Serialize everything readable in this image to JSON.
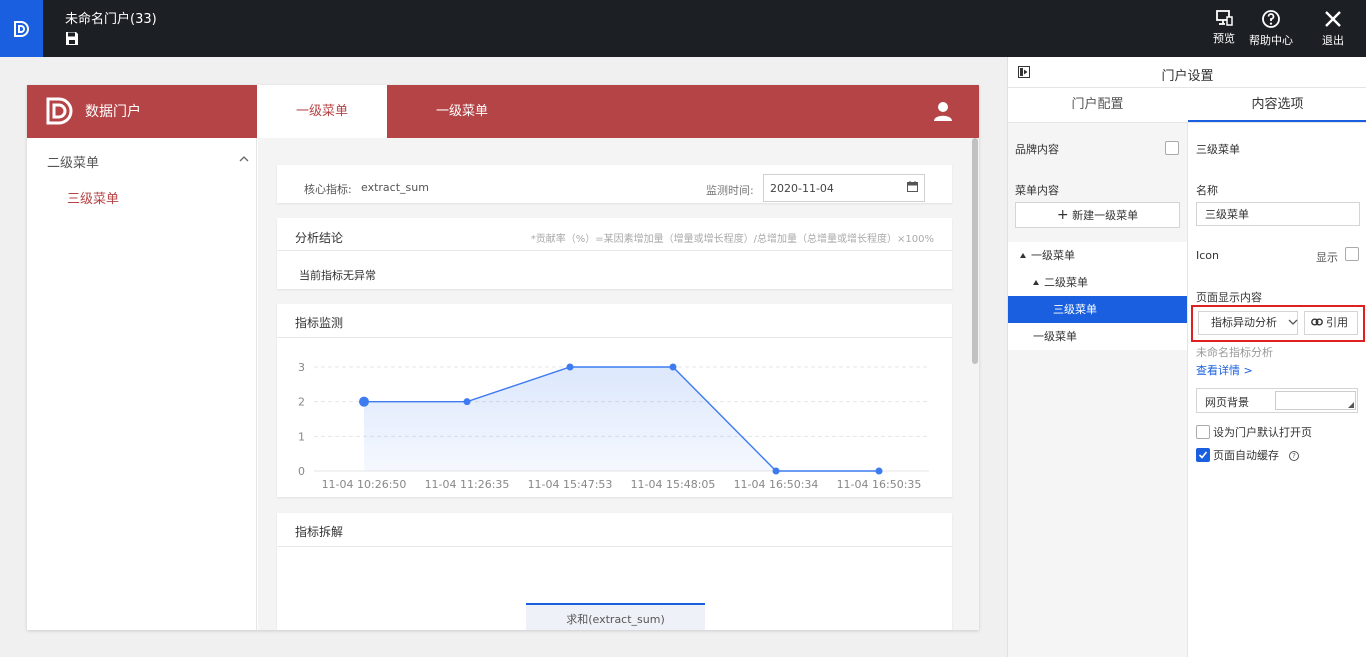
{
  "topbar": {
    "title": "未命名门户(33)",
    "actions": [
      {
        "label": "预览",
        "icon": "preview-icon"
      },
      {
        "label": "帮助中心",
        "icon": "help-icon"
      },
      {
        "label": "退出",
        "icon": "close-icon"
      }
    ]
  },
  "preview": {
    "brand": "数据门户",
    "tabs": [
      "一级菜单",
      "一级菜单"
    ],
    "sidebar": {
      "level2": "二级菜单",
      "level3": "三级菜单"
    },
    "filter": {
      "core_label": "核心指标:",
      "core_value": "extract_sum",
      "monitor_label": "监测时间:",
      "monitor_date": "2020-11-04"
    },
    "analysis": {
      "title": "分析结论",
      "formula": "*贡献率（%）=某因素增加量（增量或增长程度）/总增加量（总增量或增长程度）×100%",
      "result": "当前指标无异常"
    },
    "monitor": {
      "title": "指标监测"
    },
    "decompose": {
      "title": "指标拆解",
      "table_header": "求和(extract_sum)"
    }
  },
  "chart_data": {
    "type": "area",
    "categories": [
      "11-04 10:26:50",
      "11-04 11:26:35",
      "11-04 15:47:53",
      "11-04 15:48:05",
      "11-04 16:50:34",
      "11-04 16:50:35"
    ],
    "values": [
      2,
      2,
      3,
      3,
      0,
      0
    ],
    "ylim": [
      0,
      3
    ],
    "yticks": [
      0,
      1,
      2,
      3
    ],
    "grid": true,
    "color": "#3d7bf0"
  },
  "right_panel": {
    "title": "门户设置",
    "tabs": [
      "门户配置",
      "内容选项"
    ],
    "left": {
      "brand_content": "品牌内容",
      "menu_content": "菜单内容",
      "new_menu_button": "新建一级菜单",
      "tree": [
        {
          "label": "一级菜单",
          "level": 1,
          "expanded": true
        },
        {
          "label": "二级菜单",
          "level": 2,
          "expanded": true
        },
        {
          "label": "三级菜单",
          "level": 3,
          "selected": true
        },
        {
          "label": "一级菜单",
          "level": 1
        }
      ]
    },
    "right": {
      "section": "三级菜单",
      "name_label": "名称",
      "name_value": "三级菜单",
      "icon_label": "Icon",
      "show_label": "显示",
      "page_content_label": "页面显示内容",
      "content_select": "指标异动分析",
      "reference_button": "引用",
      "unnamed_analysis": "未命名指标分析",
      "detail_link": "查看详情 >",
      "bg_label": "网页背景",
      "default_open_label": "设为门户默认打开页",
      "autosave_label": "页面自动缓存",
      "autosave_checked": true
    }
  },
  "colors": {
    "topbar": "#1c1f24",
    "accent": "#1a5fe0",
    "portal_header": "#b54446",
    "highlight_box": "#e02020"
  }
}
